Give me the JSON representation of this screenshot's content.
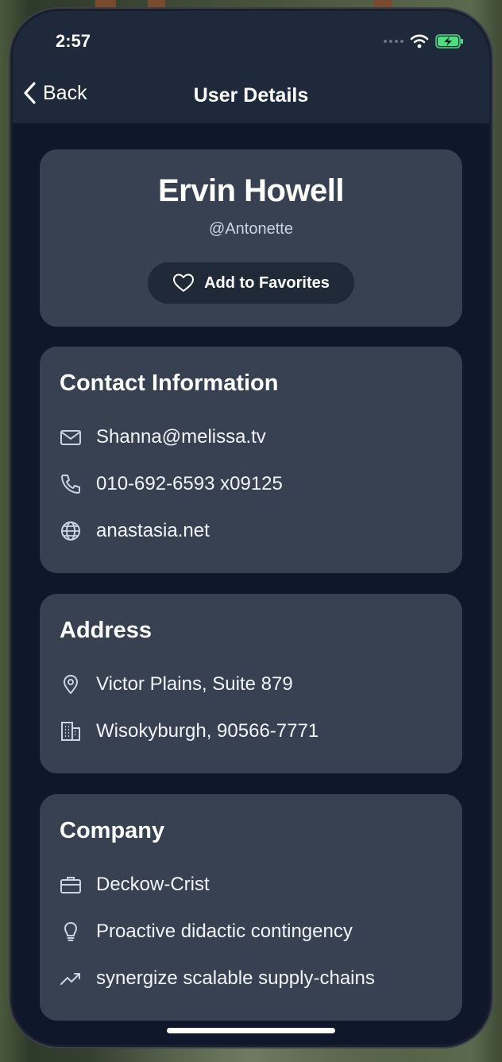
{
  "status": {
    "time": "2:57"
  },
  "nav": {
    "back_label": "Back",
    "title": "User Details"
  },
  "profile": {
    "name": "Ervin Howell",
    "username": "@Antonette",
    "favorite_button": "Add to Favorites"
  },
  "contact": {
    "title": "Contact Information",
    "email": "Shanna@melissa.tv",
    "phone": "010-692-6593 x09125",
    "website": "anastasia.net"
  },
  "address": {
    "title": "Address",
    "street": "Victor Plains, Suite 879",
    "city_zip": "Wisokyburgh, 90566-7771"
  },
  "company": {
    "title": "Company",
    "name": "Deckow-Crist",
    "catch_phrase": "Proactive didactic contingency",
    "bs": "synergize scalable supply-chains"
  },
  "icons": {
    "back": "chevron-left-icon",
    "favorite": "heart-icon",
    "email": "envelope-icon",
    "phone": "phone-icon",
    "website": "globe-icon",
    "street": "map-pin-icon",
    "city": "building-icon",
    "company": "briefcase-icon",
    "catch_phrase": "lightbulb-icon",
    "bs": "trending-up-icon",
    "wifi": "wifi-icon",
    "battery": "battery-charging-icon"
  },
  "colors": {
    "background": "#0f172a",
    "card": "#374151",
    "header": "#1e293b",
    "battery": "#4ade80"
  }
}
